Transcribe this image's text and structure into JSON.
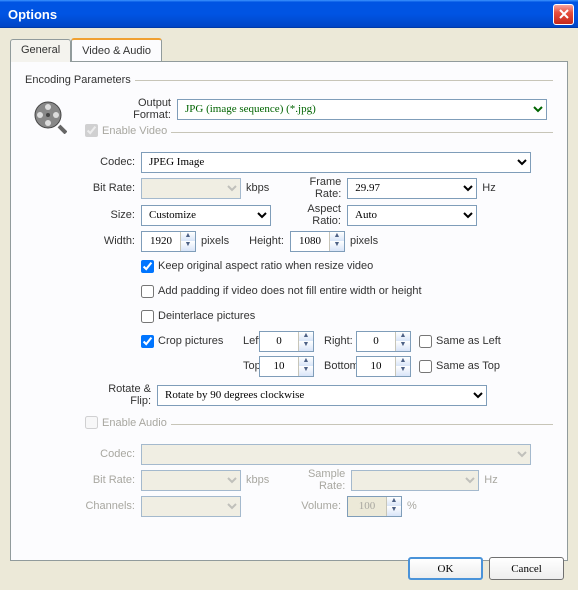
{
  "window": {
    "title": "Options"
  },
  "tabs": {
    "general": "General",
    "video_audio": "Video & Audio"
  },
  "group": {
    "encoding": "Encoding Parameters",
    "enable_video": "Enable Video",
    "enable_audio": "Enable Audio"
  },
  "labels": {
    "output_format": "Output Format:",
    "codec": "Codec:",
    "bit_rate": "Bit Rate:",
    "kbps": "kbps",
    "frame_rate": "Frame Rate:",
    "hz": "Hz",
    "size": "Size:",
    "aspect_ratio": "Aspect Ratio:",
    "width": "Width:",
    "pixels": "pixels",
    "height": "Height:",
    "keep_aspect": "Keep original aspect ratio when resize video",
    "add_padding": "Add padding if video does not fill entire width or height",
    "deinterlace": "Deinterlace pictures",
    "crop": "Crop pictures",
    "left": "Left:",
    "right": "Right:",
    "same_as_left": "Same as Left",
    "top": "Top:",
    "bottom": "Bottom:",
    "same_as_top": "Same as Top",
    "rotate_flip": "Rotate & Flip:",
    "sample_rate": "Sample Rate:",
    "channels": "Channels:",
    "volume": "Volume:",
    "percent": "%"
  },
  "values": {
    "output_format": "JPG (image sequence) (*.jpg)",
    "video_codec": "JPEG Image",
    "video_bitrate": "",
    "frame_rate": "29.97",
    "size": "Customize",
    "aspect": "Auto",
    "width": "1920",
    "height": "1080",
    "crop_left": "0",
    "crop_right": "0",
    "crop_top": "10",
    "crop_bottom": "10",
    "rotate": "Rotate by 90 degrees clockwise",
    "audio_codec": "",
    "audio_bitrate": "",
    "sample_rate": "",
    "channels": "",
    "volume": "100"
  },
  "checks": {
    "enable_video": true,
    "keep_aspect": true,
    "add_padding": false,
    "deinterlace": false,
    "crop": true,
    "same_left": false,
    "same_top": false,
    "enable_audio": false
  },
  "buttons": {
    "ok": "OK",
    "cancel": "Cancel"
  }
}
